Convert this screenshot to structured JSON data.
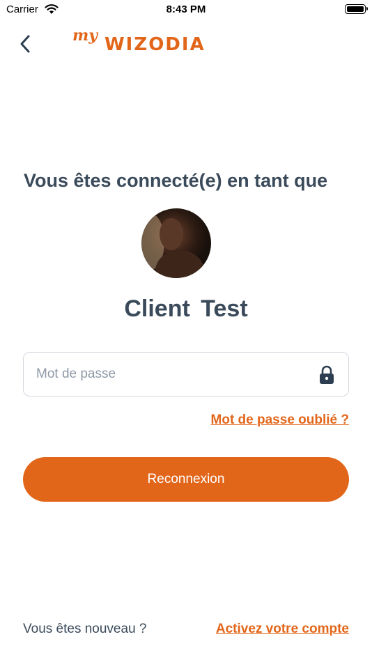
{
  "status_bar": {
    "carrier": "Carrier",
    "time": "8:43 PM",
    "wifi_icon": "wifi-icon",
    "battery_icon": "battery-icon"
  },
  "header": {
    "back_icon": "chevron-left-icon",
    "logo_prefix": "my",
    "logo_name": "WIZODIA"
  },
  "main": {
    "heading": "Vous êtes connecté(e) en tant que",
    "user_name": "Client  Test",
    "password": {
      "placeholder": "Mot de passe",
      "value": "",
      "icon": "lock-icon"
    },
    "forgot_password_label": "Mot de passe oublié ?",
    "reconnect_label": "Reconnexion"
  },
  "footer": {
    "new_user_text": "Vous êtes nouveau ?",
    "activate_label": "Activez votre compte"
  },
  "colors": {
    "accent": "#e2661a",
    "text": "#3a4a5a",
    "placeholder": "#8e99a6",
    "border": "#d2d8df"
  }
}
